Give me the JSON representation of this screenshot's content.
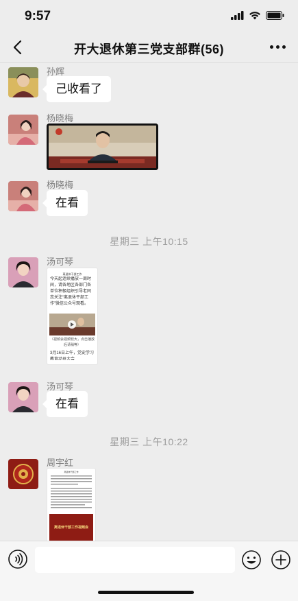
{
  "status_bar": {
    "time": "9:57"
  },
  "header": {
    "title": "开大退休第三党支部群(56)"
  },
  "messages": [
    {
      "sender": "孙辉",
      "text": "己收看了"
    },
    {
      "sender": "杨晓梅"
    },
    {
      "sender": "杨晓梅",
      "text": "在看"
    },
    {
      "sender": "汤可琴"
    },
    {
      "sender": "汤可琴",
      "text": "在看"
    },
    {
      "sender": "周宇红"
    }
  ],
  "time_separators": [
    "星期三 上午10:15",
    "星期三 上午10:22"
  ],
  "article1": {
    "header": "离退休干部工作",
    "body": "今天起连续播放一周时间，请各地区各部门各单位积极组织引导老同志关注“离退休干部工作”微信公众号观看。",
    "caption": "（视频会视频较大，点击播放后请稍等）",
    "footer": "3月16日上午，党史学习教育动员大会"
  },
  "article2": {
    "header": "离退休干部工作",
    "banner": "离退休干部工作视频会"
  },
  "icons": {
    "back": "chevron-left-icon",
    "more": "more-dots-icon",
    "voice": "voice-icon",
    "emoji": "emoji-icon",
    "plus": "plus-icon",
    "signal": "signal-icon",
    "wifi": "wifi-icon",
    "battery": "battery-icon",
    "play": "play-icon"
  },
  "colors": {
    "background": "#ededed",
    "bubble": "#ffffff",
    "accent_red": "#b0261c"
  }
}
